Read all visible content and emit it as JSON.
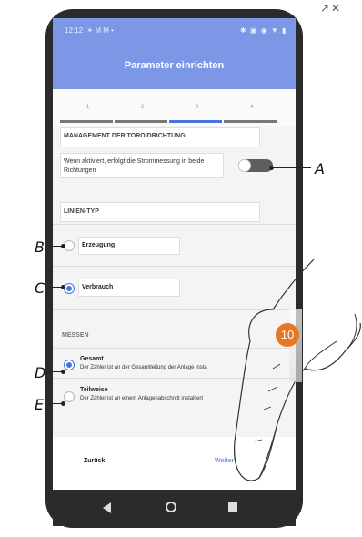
{
  "status": {
    "time": "12:12",
    "icons_left": "✶ M M •",
    "icons_right": "✱ ▣ ◉ ▼ ▮"
  },
  "corner": {
    "icons": "↗✕"
  },
  "header": {
    "title": "Parameter einrichten"
  },
  "steps": {
    "labels": [
      "1",
      "2",
      "3",
      "4"
    ],
    "active": 3
  },
  "section1": {
    "title": "MANAGEMENT DER TOROIDRICHTUNG",
    "toggle_text": "Wenn aktiviert, erfolgt die Strommessung in beide Richtungen",
    "toggle_on": false
  },
  "section2": {
    "title": "LINIEN-TYP",
    "options": [
      {
        "label": "Erzeugung",
        "selected": false
      },
      {
        "label": "Verbrauch",
        "selected": true
      }
    ]
  },
  "section3": {
    "title": "MESSEN",
    "options": [
      {
        "label": "Gesamt",
        "desc": "Der Zähler ist an der Gesamtleitung der Anlage insta",
        "selected": true
      },
      {
        "label": "Teilweise",
        "desc": "Der Zähler ist an einem Anlagenabschnitt installiert",
        "selected": false
      }
    ]
  },
  "footer": {
    "back": "Zurück",
    "next": "Weiter"
  },
  "callouts": {
    "A": "A",
    "B": "B",
    "C": "C",
    "D": "D",
    "E": "E"
  },
  "badge": "10",
  "colors": {
    "header": "#7b97e6",
    "accent": "#4a73e0",
    "badge": "#e87722"
  }
}
